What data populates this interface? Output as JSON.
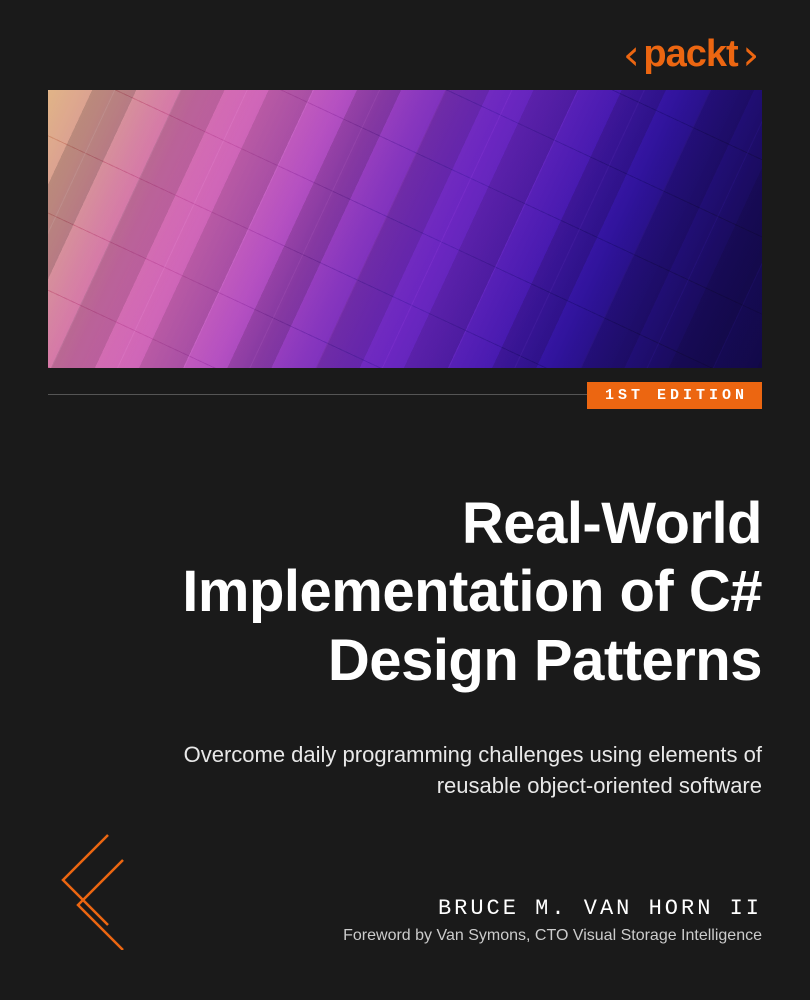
{
  "publisher": "packt",
  "edition_badge": "1ST EDITION",
  "title": "Real-World Implementation of C# Design Patterns",
  "subtitle": "Overcome daily programming challenges using elements of reusable object-oriented software",
  "author": "BRUCE M. VAN HORN II",
  "foreword": "Foreword by Van Symons, CTO Visual Storage Intelligence",
  "colors": {
    "accent": "#ec6611",
    "background": "#1a1a1a"
  }
}
